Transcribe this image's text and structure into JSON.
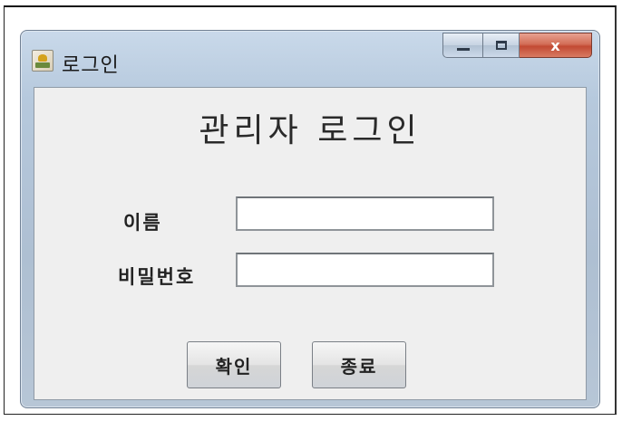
{
  "window": {
    "title": "로그인",
    "close_glyph": "x"
  },
  "form": {
    "heading": "관리자 로그인",
    "name_label": "이름",
    "name_value": "",
    "password_label": "비밀번호",
    "password_value": "",
    "confirm_label": "확인",
    "exit_label": "종료"
  },
  "colors": {
    "close_button": "#c24a33",
    "client_background": "#efefef"
  }
}
